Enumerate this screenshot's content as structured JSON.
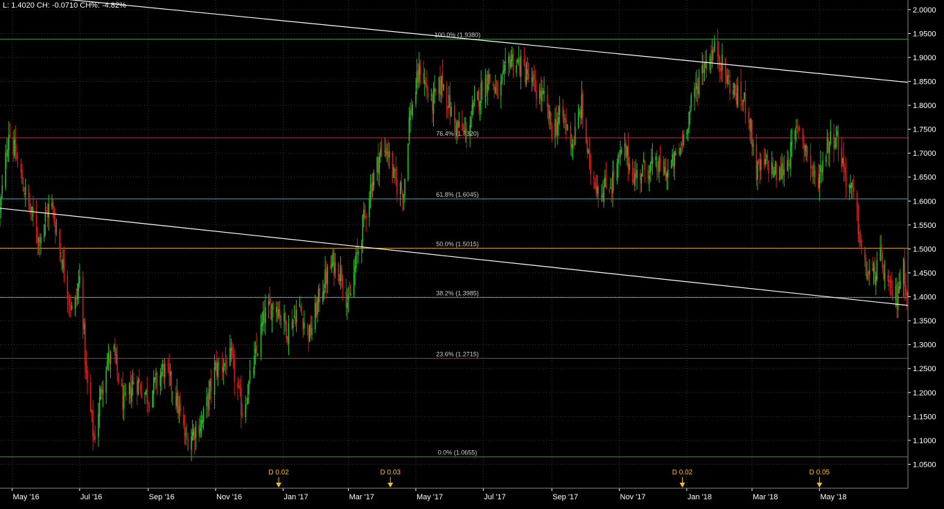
{
  "header": {
    "info": "L: 1.4020 CH: -0.0710 CH%: -4.82%"
  },
  "colors": {
    "background": "#000000",
    "grid": "#3a3a3a",
    "axis_text": "#ffffff",
    "candle_up": "#22c22a",
    "candle_down": "#d21f1f",
    "trendline": "#ffffff",
    "fib_green": "#3c9a3c",
    "fib_red": "#c03030",
    "fib_cyan": "#3ab0c0",
    "fib_orange": "#e0a020",
    "dividend": "#f0c020"
  },
  "chart_data": {
    "type": "candlestick",
    "title": "",
    "xlabel": "",
    "ylabel": "",
    "x_range": [
      "2016-04-20",
      "2018-07-20"
    ],
    "ylim": [
      1.0,
      2.02
    ],
    "y_ticks": [
      "1.0500",
      "1.1000",
      "1.1500",
      "1.2000",
      "1.2500",
      "1.3000",
      "1.3500",
      "1.4000",
      "1.4500",
      "1.5000",
      "1.5500",
      "1.6000",
      "1.6500",
      "1.7000",
      "1.7500",
      "1.8000",
      "1.8500",
      "1.9000",
      "1.9500",
      "2.0000"
    ],
    "x_ticks": [
      {
        "label": "May '16",
        "date": "2016-05-01"
      },
      {
        "label": "Jul '16",
        "date": "2016-07-01"
      },
      {
        "label": "Sep '16",
        "date": "2016-09-01"
      },
      {
        "label": "Nov '16",
        "date": "2016-11-01"
      },
      {
        "label": "Jan '17",
        "date": "2017-01-01"
      },
      {
        "label": "Mar '17",
        "date": "2017-03-01"
      },
      {
        "label": "May '17",
        "date": "2017-05-01"
      },
      {
        "label": "Jul '17",
        "date": "2017-07-01"
      },
      {
        "label": "Sep '17",
        "date": "2017-09-01"
      },
      {
        "label": "Nov '17",
        "date": "2017-11-01"
      },
      {
        "label": "Jan '18",
        "date": "2018-01-01"
      },
      {
        "label": "Mar '18",
        "date": "2018-03-01"
      },
      {
        "label": "May '18",
        "date": "2018-05-01"
      }
    ],
    "price_path": [
      {
        "date": "2016-04-20",
        "close": 1.58
      },
      {
        "date": "2016-04-28",
        "close": 1.75
      },
      {
        "date": "2016-05-10",
        "close": 1.64
      },
      {
        "date": "2016-05-25",
        "close": 1.52
      },
      {
        "date": "2016-06-05",
        "close": 1.6
      },
      {
        "date": "2016-06-18",
        "close": 1.44
      },
      {
        "date": "2016-06-25",
        "close": 1.36
      },
      {
        "date": "2016-07-02",
        "close": 1.45
      },
      {
        "date": "2016-07-07",
        "close": 1.23
      },
      {
        "date": "2016-07-14",
        "close": 1.1
      },
      {
        "date": "2016-07-24",
        "close": 1.26
      },
      {
        "date": "2016-08-01",
        "close": 1.28
      },
      {
        "date": "2016-08-10",
        "close": 1.17
      },
      {
        "date": "2016-08-20",
        "close": 1.23
      },
      {
        "date": "2016-09-01",
        "close": 1.19
      },
      {
        "date": "2016-09-15",
        "close": 1.25
      },
      {
        "date": "2016-09-25",
        "close": 1.2
      },
      {
        "date": "2016-10-05",
        "close": 1.1
      },
      {
        "date": "2016-10-20",
        "close": 1.14
      },
      {
        "date": "2016-11-01",
        "close": 1.25
      },
      {
        "date": "2016-11-15",
        "close": 1.27
      },
      {
        "date": "2016-11-25",
        "close": 1.16
      },
      {
        "date": "2016-12-05",
        "close": 1.25
      },
      {
        "date": "2016-12-15",
        "close": 1.36
      },
      {
        "date": "2016-12-25",
        "close": 1.39
      },
      {
        "date": "2017-01-05",
        "close": 1.33
      },
      {
        "date": "2017-01-15",
        "close": 1.38
      },
      {
        "date": "2017-01-25",
        "close": 1.32
      },
      {
        "date": "2017-02-05",
        "close": 1.42
      },
      {
        "date": "2017-02-15",
        "close": 1.47
      },
      {
        "date": "2017-02-23",
        "close": 1.45
      },
      {
        "date": "2017-03-01",
        "close": 1.38
      },
      {
        "date": "2017-03-10",
        "close": 1.5
      },
      {
        "date": "2017-03-20",
        "close": 1.62
      },
      {
        "date": "2017-03-30",
        "close": 1.7
      },
      {
        "date": "2017-04-05",
        "close": 1.71
      },
      {
        "date": "2017-04-12",
        "close": 1.64
      },
      {
        "date": "2017-04-20",
        "close": 1.62
      },
      {
        "date": "2017-04-25",
        "close": 1.77
      },
      {
        "date": "2017-05-05",
        "close": 1.88
      },
      {
        "date": "2017-05-15",
        "close": 1.8
      },
      {
        "date": "2017-05-25",
        "close": 1.85
      },
      {
        "date": "2017-06-05",
        "close": 1.76
      },
      {
        "date": "2017-06-15",
        "close": 1.74
      },
      {
        "date": "2017-06-25",
        "close": 1.81
      },
      {
        "date": "2017-07-05",
        "close": 1.86
      },
      {
        "date": "2017-07-15",
        "close": 1.82
      },
      {
        "date": "2017-07-25",
        "close": 1.9
      },
      {
        "date": "2017-08-05",
        "close": 1.88
      },
      {
        "date": "2017-08-15",
        "close": 1.84
      },
      {
        "date": "2017-08-25",
        "close": 1.81
      },
      {
        "date": "2017-09-01",
        "close": 1.75
      },
      {
        "date": "2017-09-10",
        "close": 1.78
      },
      {
        "date": "2017-09-20",
        "close": 1.72
      },
      {
        "date": "2017-09-28",
        "close": 1.8
      },
      {
        "date": "2017-10-05",
        "close": 1.67
      },
      {
        "date": "2017-10-15",
        "close": 1.62
      },
      {
        "date": "2017-10-25",
        "close": 1.64
      },
      {
        "date": "2017-11-05",
        "close": 1.71
      },
      {
        "date": "2017-11-15",
        "close": 1.65
      },
      {
        "date": "2017-11-25",
        "close": 1.67
      },
      {
        "date": "2017-12-05",
        "close": 1.67
      },
      {
        "date": "2017-12-15",
        "close": 1.66
      },
      {
        "date": "2017-12-25",
        "close": 1.7
      },
      {
        "date": "2018-01-05",
        "close": 1.8
      },
      {
        "date": "2018-01-15",
        "close": 1.88
      },
      {
        "date": "2018-01-28",
        "close": 1.92
      },
      {
        "date": "2018-02-05",
        "close": 1.86
      },
      {
        "date": "2018-02-15",
        "close": 1.82
      },
      {
        "date": "2018-02-25",
        "close": 1.8
      },
      {
        "date": "2018-03-05",
        "close": 1.66
      },
      {
        "date": "2018-03-15",
        "close": 1.68
      },
      {
        "date": "2018-03-25",
        "close": 1.65
      },
      {
        "date": "2018-04-05",
        "close": 1.7
      },
      {
        "date": "2018-04-12",
        "close": 1.76
      },
      {
        "date": "2018-04-20",
        "close": 1.7
      },
      {
        "date": "2018-04-28",
        "close": 1.63
      },
      {
        "date": "2018-05-08",
        "close": 1.72
      },
      {
        "date": "2018-05-16",
        "close": 1.74
      },
      {
        "date": "2018-05-25",
        "close": 1.65
      },
      {
        "date": "2018-06-02",
        "close": 1.6
      },
      {
        "date": "2018-06-10",
        "close": 1.46
      },
      {
        "date": "2018-06-18",
        "close": 1.44
      },
      {
        "date": "2018-06-25",
        "close": 1.48
      },
      {
        "date": "2018-07-03",
        "close": 1.41
      },
      {
        "date": "2018-07-10",
        "close": 1.4
      },
      {
        "date": "2018-07-15",
        "close": 1.47
      },
      {
        "date": "2018-07-20",
        "close": 1.4
      }
    ],
    "trendlines": [
      {
        "start": {
          "date": "2016-04-20",
          "value": 2.035
        },
        "end": {
          "date": "2018-07-20",
          "value": 1.848
        }
      },
      {
        "start": {
          "date": "2016-04-20",
          "value": 1.585
        },
        "end": {
          "date": "2018-07-20",
          "value": 1.382
        }
      }
    ],
    "fib_levels": [
      {
        "label": "100.0% (1.9380)",
        "value": 1.938,
        "color": "fib_green"
      },
      {
        "label": "76.4% (1.7320)",
        "value": 1.732,
        "color": "fib_red"
      },
      {
        "label": "61.8% (1.6045)",
        "value": 1.6045,
        "color": "fib_cyan"
      },
      {
        "label": "50.0% (1.5015)",
        "value": 1.5015,
        "color": "fib_orange"
      },
      {
        "label": "38.2% (1.3985)",
        "value": 1.3985,
        "color": "fib_cyan"
      },
      {
        "label": "23.6% (1.2715)",
        "value": 1.2715,
        "color": "fib_red"
      },
      {
        "label": "0.0% (1.0655)",
        "value": 1.0655,
        "color": "fib_green"
      }
    ],
    "dividends": [
      {
        "label": "D 0.02",
        "date": "2016-12-28"
      },
      {
        "label": "D 0.03",
        "date": "2017-04-08"
      },
      {
        "label": "D 0.02",
        "date": "2017-12-28"
      },
      {
        "label": "D 0.05",
        "date": "2018-05-01"
      }
    ]
  }
}
